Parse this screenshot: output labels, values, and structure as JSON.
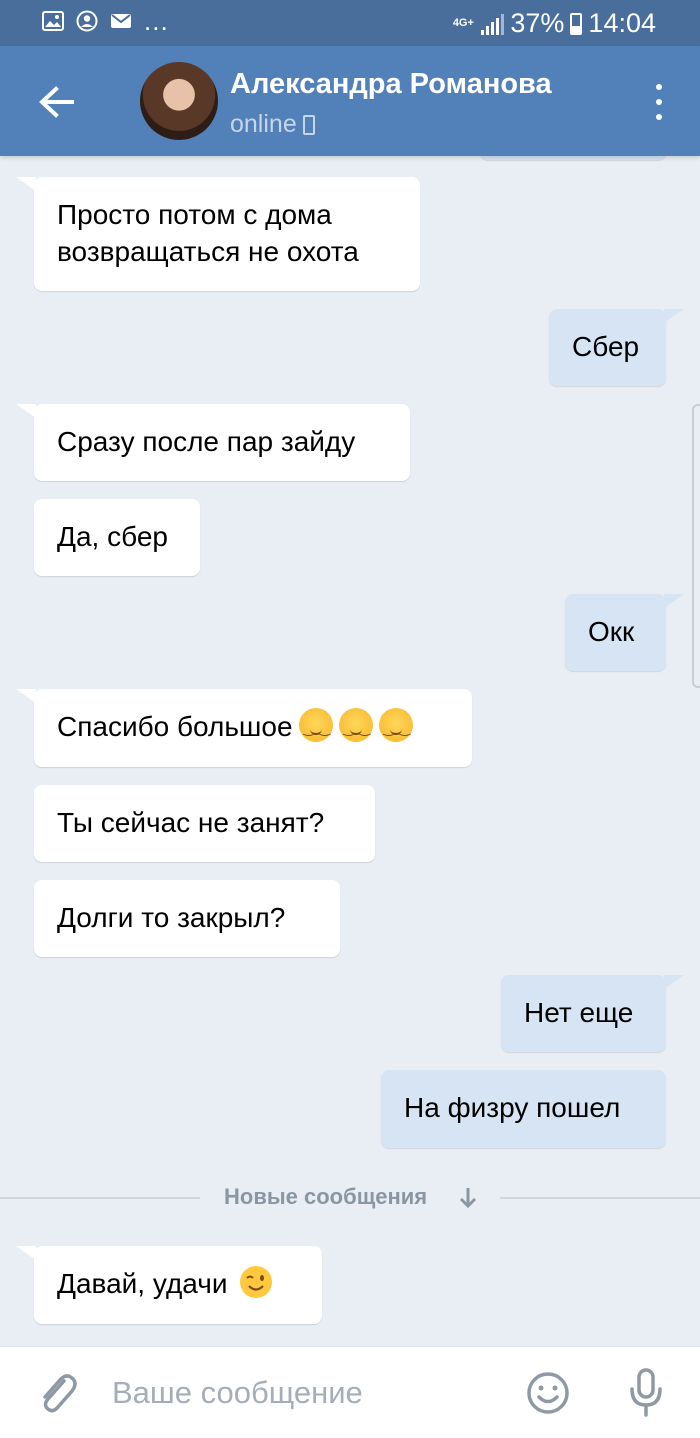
{
  "status_bar": {
    "dots": "...",
    "network": "4G+",
    "battery": "37%",
    "time": "14:04",
    "battery_level": 0.37
  },
  "header": {
    "name": "Александра Романова",
    "status": "online"
  },
  "messages": [
    {
      "dir": "in",
      "text": "Просто потом с дома\nвозвращаться не охота"
    },
    {
      "dir": "out",
      "text": "Сбер"
    },
    {
      "dir": "in",
      "text": "Сразу после пар зайду"
    },
    {
      "dir": "in",
      "text": "Да, сбер"
    },
    {
      "dir": "out",
      "text": "Окк"
    },
    {
      "dir": "in",
      "text": "Спасибо большое",
      "emojis": [
        "smiling-face",
        "smiling-face",
        "smiling-face"
      ]
    },
    {
      "dir": "in",
      "text": "Ты сейчас не занят?"
    },
    {
      "dir": "in",
      "text": "Долги то закрыл?"
    },
    {
      "dir": "out",
      "text": "Нет еще"
    },
    {
      "dir": "out",
      "text": "На физру пошел"
    },
    {
      "dir": "in",
      "text": "Давай, удачи",
      "emojis": [
        "winking-face"
      ]
    }
  ],
  "divider": {
    "label": "Новые сообщения"
  },
  "composer": {
    "placeholder": "Ваше сообщение"
  },
  "colors": {
    "status_bar": "#4a6e9b",
    "header": "#5181b8",
    "background": "#e9eef4",
    "incoming_bubble": "#ffffff",
    "outgoing_bubble": "#d6e4f4"
  },
  "icons": [
    "gallery-icon",
    "account-icon",
    "mail-icon",
    "signal-icon",
    "battery-icon",
    "back-arrow-icon",
    "more-vertical-icon",
    "phone-icon",
    "down-arrow-icon",
    "paperclip-icon",
    "smile-icon",
    "microphone-icon"
  ]
}
